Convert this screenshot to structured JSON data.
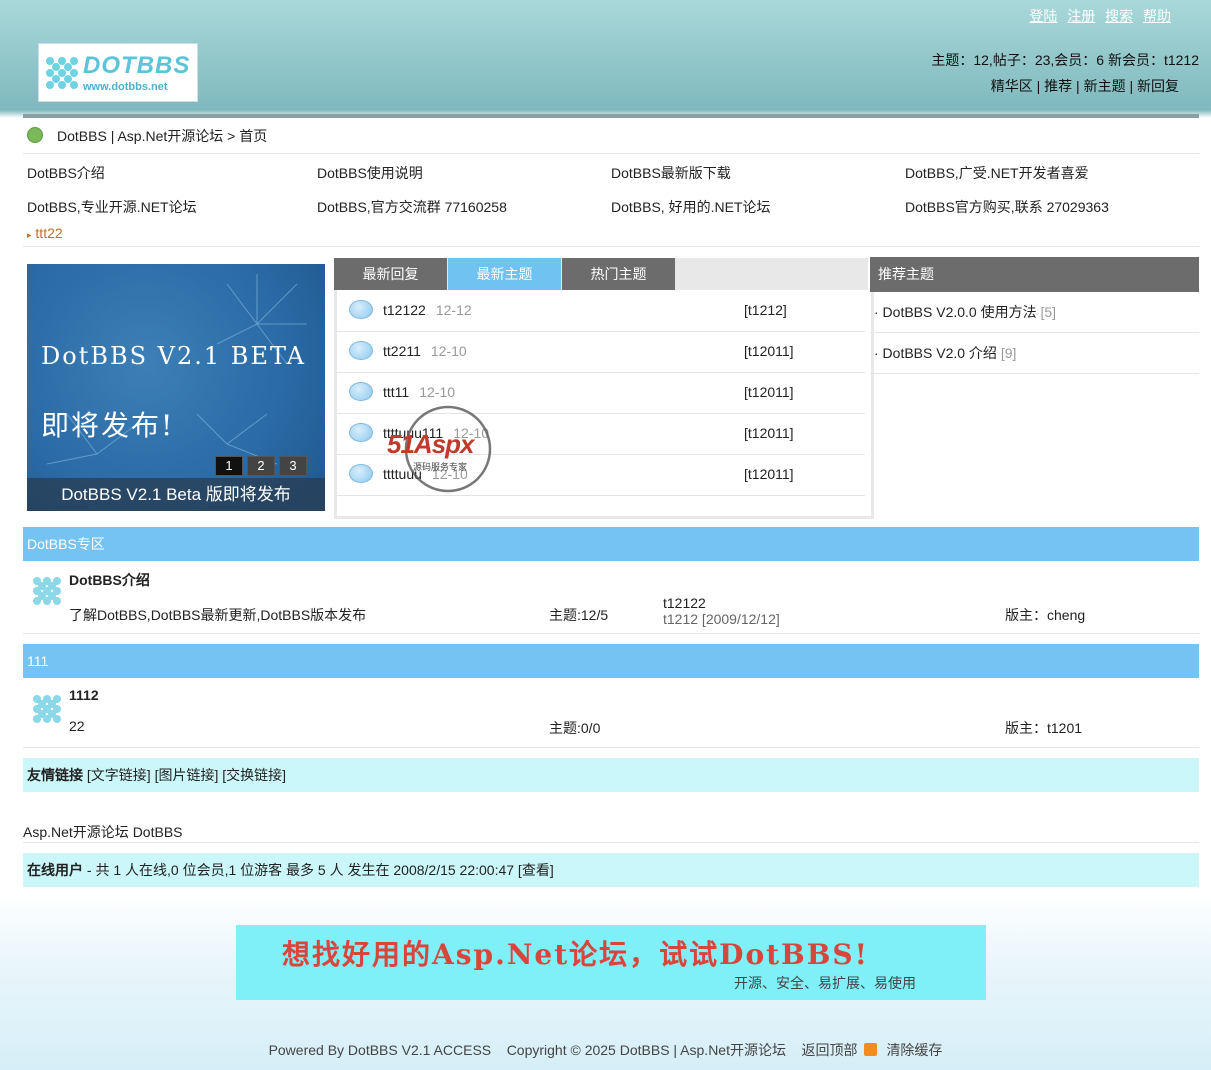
{
  "top_links": [
    "登陆",
    "注册",
    "搜索",
    "帮助"
  ],
  "logo": {
    "name": "DOTBBS",
    "url_text": "www.dotbbs.net"
  },
  "stats_text": "主题：12,帖子：23,会员：6 新会员：t1212",
  "quick_links": [
    "精华区",
    "推荐",
    "新主题",
    "新回复"
  ],
  "breadcrumb": "DotBBS | Asp.Net开源论坛 > 首页",
  "intro_links": [
    [
      "DotBBS介绍",
      "DotBBS使用说明",
      "DotBBS最新版下载",
      "DotBBS,广受.NET开发者喜爱"
    ],
    [
      "DotBBS,专业开源.NET论坛",
      "DotBBS,官方交流群 77160258",
      "DotBBS, 好用的.NET论坛",
      "DotBBS官方购买,联系 27029363"
    ]
  ],
  "extra_link": "ttt22",
  "slideshow": {
    "title_line1": "DotBBS V2.1 BETA",
    "title_line2": "即将发布!",
    "pages": [
      "1",
      "2",
      "3"
    ],
    "caption": "DotBBS V2.1 Beta 版即将发布"
  },
  "tabs": [
    "最新回复",
    "最新主题",
    "热门主题"
  ],
  "active_tab": "最新主题",
  "topics": [
    {
      "title": "t12122",
      "date": "12-12",
      "author": "[t1212]"
    },
    {
      "title": "tt2211",
      "date": "12-10",
      "author": "[t12011]"
    },
    {
      "title": "ttt11",
      "date": "12-10",
      "author": "[t12011]"
    },
    {
      "title": "ttttuuu111",
      "date": "12-10",
      "author": "[t12011]"
    },
    {
      "title": "ttttuuu",
      "date": "12-10",
      "author": "[t12011]"
    }
  ],
  "recommended": {
    "header": "推荐主题",
    "items": [
      {
        "title": "· DotBBS V2.0.0 使用方法",
        "count": "[5]"
      },
      {
        "title": "· DotBBS V2.0 介绍",
        "count": "[9]"
      }
    ]
  },
  "sections": [
    {
      "header": "DotBBS专区",
      "forum": {
        "name": "DotBBS介绍",
        "desc": "了解DotBBS,DotBBS最新更新,DotBBS版本发布",
        "count": "主题:12/5",
        "last_title": "t12122",
        "last_info": "t1212 [2009/12/12]",
        "moderator": "版主：cheng"
      }
    },
    {
      "header": "111",
      "forum": {
        "name": "1112",
        "desc": "22",
        "count": "主题:0/0",
        "last_title": "",
        "last_info": "",
        "moderator": "版主：t1201"
      }
    }
  ],
  "friend_links": {
    "label": "友情链接",
    "items": [
      "[文字链接]",
      "[图片链接]",
      "[交换链接]"
    ]
  },
  "site_name": "Asp.Net开源论坛 DotBBS",
  "online": {
    "label": "在线用户",
    "text": " - 共 1 人在线,0 位会员,1 位游客  最多 5 人  发生在 2008/2/15 22:00:47 [查看]"
  },
  "banner": {
    "headline": "想找好用的Asp.Net论坛，试试DotBBS!",
    "sub": "开源、安全、易扩展、易使用"
  },
  "footer": {
    "powered": "Powered By DotBBS V2.1 ACCESS",
    "copyright": "Copyright © 2025 DotBBS | Asp.Net开源论坛",
    "back_top": "返回顶部",
    "clear_cache": "清除缓存"
  },
  "watermark": {
    "brand": "51Aspx",
    "tagline": "源码服务专家"
  },
  "colors": {
    "tab_active": "#70c2f0",
    "tab_inactive": "#6c6c6c",
    "section_header": "#75c3f3",
    "info_bar": "#ccf7fa",
    "banner_bg": "#7ff0f8",
    "banner_text": "#d9443b"
  }
}
